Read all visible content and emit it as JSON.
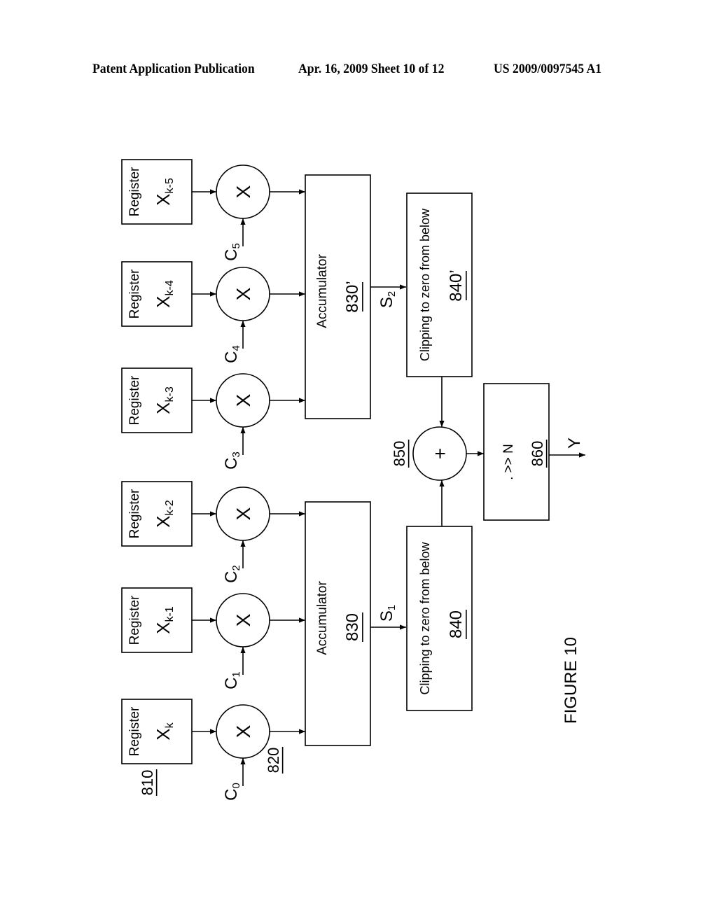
{
  "header": {
    "publication": "Patent Application Publication",
    "date_sheet": "Apr. 16, 2009  Sheet 10 of 12",
    "number": "US 2009/0097545 A1"
  },
  "figure": {
    "caption": "FIGURE 10",
    "registers": [
      {
        "label": "Register",
        "var": "X",
        "sub": "k"
      },
      {
        "label": "Register",
        "var": "X",
        "sub": "k-1"
      },
      {
        "label": "Register",
        "var": "X",
        "sub": "k-2"
      },
      {
        "label": "Register",
        "var": "X",
        "sub": "k-3"
      },
      {
        "label": "Register",
        "var": "X",
        "sub": "k-4"
      },
      {
        "label": "Register",
        "var": "X",
        "sub": "k-5"
      }
    ],
    "multipliers": [
      {
        "symbol": "X",
        "coef": "C",
        "sub": "0"
      },
      {
        "symbol": "X",
        "coef": "C",
        "sub": "1"
      },
      {
        "symbol": "X",
        "coef": "C",
        "sub": "2"
      },
      {
        "symbol": "X",
        "coef": "C",
        "sub": "3"
      },
      {
        "symbol": "X",
        "coef": "C",
        "sub": "4"
      },
      {
        "symbol": "X",
        "coef": "C",
        "sub": "5"
      }
    ],
    "ref_register": "810",
    "ref_multiplier": "820",
    "accumulators": [
      {
        "label": "Accumulator",
        "ref": "830",
        "signal": "S",
        "signal_sub": "1"
      },
      {
        "label": "Accumulator",
        "ref": "830’",
        "signal": "S",
        "signal_sub": "2"
      }
    ],
    "clippers": [
      {
        "label": "Clipping to zero from below",
        "ref": "840"
      },
      {
        "label": "Clipping to zero from below",
        "ref": "840’"
      }
    ],
    "adder": {
      "symbol": "+",
      "ref": "850"
    },
    "shifter": {
      "label": ". >> N",
      "ref": "860"
    },
    "output": "Y"
  }
}
